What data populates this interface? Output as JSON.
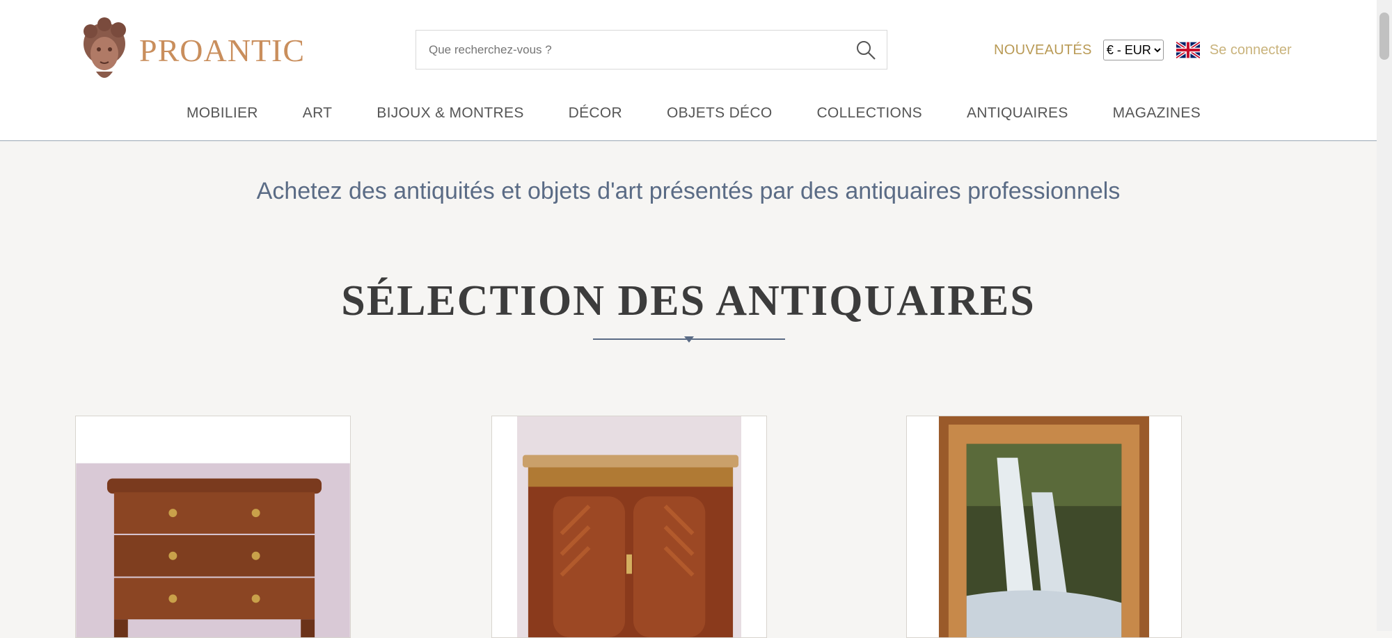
{
  "header": {
    "logo_text": "PROANTIC",
    "search_placeholder": "Que recherchez-vous ?",
    "nouveautes": "NOUVEAUTÉS",
    "currency_selected": "€ - EUR",
    "login": "Se connecter"
  },
  "nav": {
    "items": [
      {
        "label": "MOBILIER"
      },
      {
        "label": "ART"
      },
      {
        "label": "BIJOUX & MONTRES"
      },
      {
        "label": "DÉCOR"
      },
      {
        "label": "OBJETS DÉCO"
      },
      {
        "label": "COLLECTIONS"
      },
      {
        "label": "ANTIQUAIRES"
      },
      {
        "label": "MAGAZINES"
      }
    ]
  },
  "main": {
    "tagline": "Achetez des antiquités et objets d'art présentés par des antiquaires professionnels",
    "section_title": "SÉLECTION DES ANTIQUAIRES"
  },
  "colors": {
    "brand": "#c98e5c",
    "accent_gold": "#b99a55",
    "slate": "#5a6b85"
  },
  "icons": [
    "logo-head-icon",
    "search-icon",
    "uk-flag-icon"
  ]
}
